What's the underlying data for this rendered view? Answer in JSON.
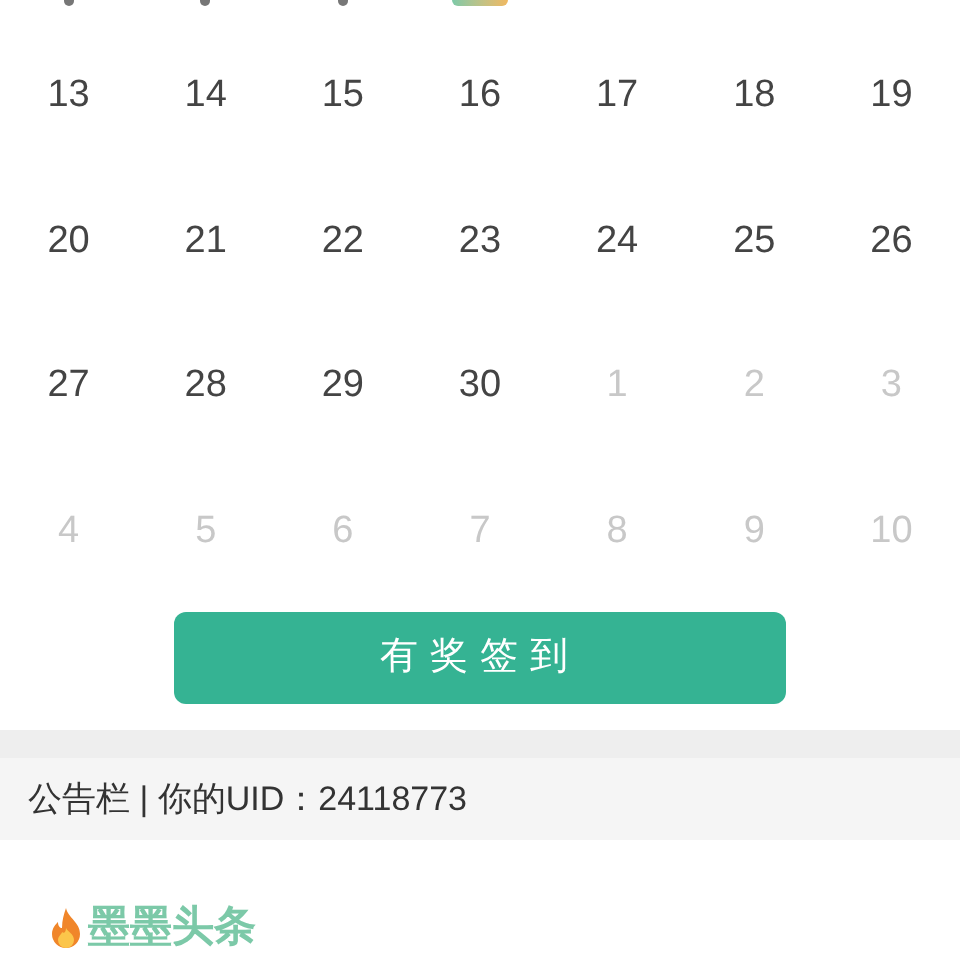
{
  "previous_row_marks": [
    {
      "kind": "dot"
    },
    {
      "kind": "dot"
    },
    {
      "kind": "dot"
    },
    {
      "kind": "badge"
    },
    {
      "kind": "none"
    },
    {
      "kind": "none"
    },
    {
      "kind": "none"
    }
  ],
  "weeks": [
    [
      {
        "day": "13",
        "in_month": true
      },
      {
        "day": "14",
        "in_month": true
      },
      {
        "day": "15",
        "in_month": true
      },
      {
        "day": "16",
        "in_month": true
      },
      {
        "day": "17",
        "in_month": true
      },
      {
        "day": "18",
        "in_month": true
      },
      {
        "day": "19",
        "in_month": true
      }
    ],
    [
      {
        "day": "20",
        "in_month": true
      },
      {
        "day": "21",
        "in_month": true
      },
      {
        "day": "22",
        "in_month": true
      },
      {
        "day": "23",
        "in_month": true
      },
      {
        "day": "24",
        "in_month": true
      },
      {
        "day": "25",
        "in_month": true
      },
      {
        "day": "26",
        "in_month": true
      }
    ],
    [
      {
        "day": "27",
        "in_month": true
      },
      {
        "day": "28",
        "in_month": true
      },
      {
        "day": "29",
        "in_month": true
      },
      {
        "day": "30",
        "in_month": true
      },
      {
        "day": "1",
        "in_month": false
      },
      {
        "day": "2",
        "in_month": false
      },
      {
        "day": "3",
        "in_month": false
      }
    ],
    [
      {
        "day": "4",
        "in_month": false
      },
      {
        "day": "5",
        "in_month": false
      },
      {
        "day": "6",
        "in_month": false
      },
      {
        "day": "7",
        "in_month": false
      },
      {
        "day": "8",
        "in_month": false
      },
      {
        "day": "9",
        "in_month": false
      },
      {
        "day": "10",
        "in_month": false
      }
    ]
  ],
  "checkin_button": "有奖签到",
  "notice_bar": "公告栏 | 你的UID：24118773",
  "news_title": "墨墨头条"
}
